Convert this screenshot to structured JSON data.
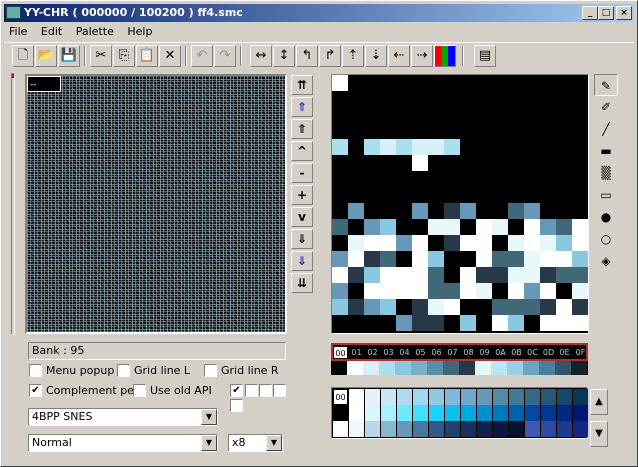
{
  "window": {
    "title": "YY-CHR ( 000000 / 100200 ) ff4.smc"
  },
  "titlebar_buttons": [
    "_",
    "□",
    "×"
  ],
  "menu": [
    "File",
    "Edit",
    "Palette",
    "Help"
  ],
  "toolbar": {
    "icons": [
      "new-icon",
      "open-icon",
      "save-icon",
      "cut-icon",
      "copy-icon",
      "paste-icon",
      "delete-icon",
      "undo-icon",
      "redo-icon",
      "flip-horizontal-icon",
      "flip-vertical-icon",
      "rotate-left-icon",
      "rotate-right-icon",
      "shift-up-icon",
      "shift-down-icon",
      "shift-left-icon",
      "shift-right-icon",
      "palette-color-icon",
      "property-icon"
    ]
  },
  "chr_view": {
    "cursor_label": "--"
  },
  "scroll_buttons": [
    "⇈",
    "⇑",
    "⇑",
    "^",
    "-",
    "+",
    "v",
    "⇓",
    "⇓",
    "⇊"
  ],
  "bank": {
    "label": "Bank : 95"
  },
  "options": {
    "menu_popup": {
      "label": "Menu popup",
      "checked": false
    },
    "grid_line_l": {
      "label": "Grid line L",
      "checked": false
    },
    "grid_line_r": {
      "label": "Grid line R",
      "checked": false
    },
    "complement_pen": {
      "label": "Complement pen",
      "checked": true
    },
    "use_old_api": {
      "label": "Use old API",
      "checked": false
    }
  },
  "format_select": {
    "value": "4BPP SNES"
  },
  "pattern_select": {
    "value": "Normal"
  },
  "zoom_select": {
    "value": "x8"
  },
  "palette_indices": [
    "00",
    "01",
    "02",
    "03",
    "04",
    "05",
    "06",
    "07",
    "08",
    "09",
    "0A",
    "0B",
    "0C",
    "0D",
    "0E",
    "0F"
  ],
  "palette_selected": "00",
  "palette_colors": [
    "#000000",
    "#ffffff",
    "#d8f0f8",
    "#a8e0f0",
    "#88c8e0",
    "#78b0c8",
    "#5890a8",
    "#406878",
    "#283848",
    "#e8f8f8",
    "#b8e8f8",
    "#98d0e8",
    "#68a8c0",
    "#4880a0",
    "#305868",
    "#182028"
  ],
  "color_grid": [
    [
      "#000000",
      "#ffffff",
      "#e8f0f8",
      "#c8e8f8",
      "#b0dcf0",
      "#a0d8f0",
      "#90c8e0",
      "#80b8d8",
      "#70a8c8",
      "#6898b8",
      "#5888a8",
      "#487898",
      "#386888",
      "#285878",
      "#184868",
      "#083858"
    ],
    [
      "#000000",
      "#ffffff",
      "#d8f8ff",
      "#a8f0ff",
      "#70e8ff",
      "#40e0ff",
      "#20d0f8",
      "#10c0e8",
      "#00a8e0",
      "#0090d0",
      "#0078c0",
      "#0060b0",
      "#0048a0",
      "#003890",
      "#002880",
      "#001870"
    ],
    [
      "#ffffff",
      "#f0f8ff",
      "#b8d8e8",
      "#88b8d0",
      "#6898b8",
      "#4878a0",
      "#305888",
      "#204070",
      "#183060",
      "#102050",
      "#081840",
      "#081030",
      "#4058b0",
      "#3048a0",
      "#203890",
      "#102880"
    ]
  ],
  "pal_scroll": [
    "▲",
    "▼"
  ],
  "tools": [
    "pen-icon",
    "pen-alt-icon",
    "line-icon",
    "rect-fill-icon",
    "dither-icon",
    "rect-icon",
    "circle-fill-icon",
    "circle-icon",
    "fill-icon"
  ]
}
